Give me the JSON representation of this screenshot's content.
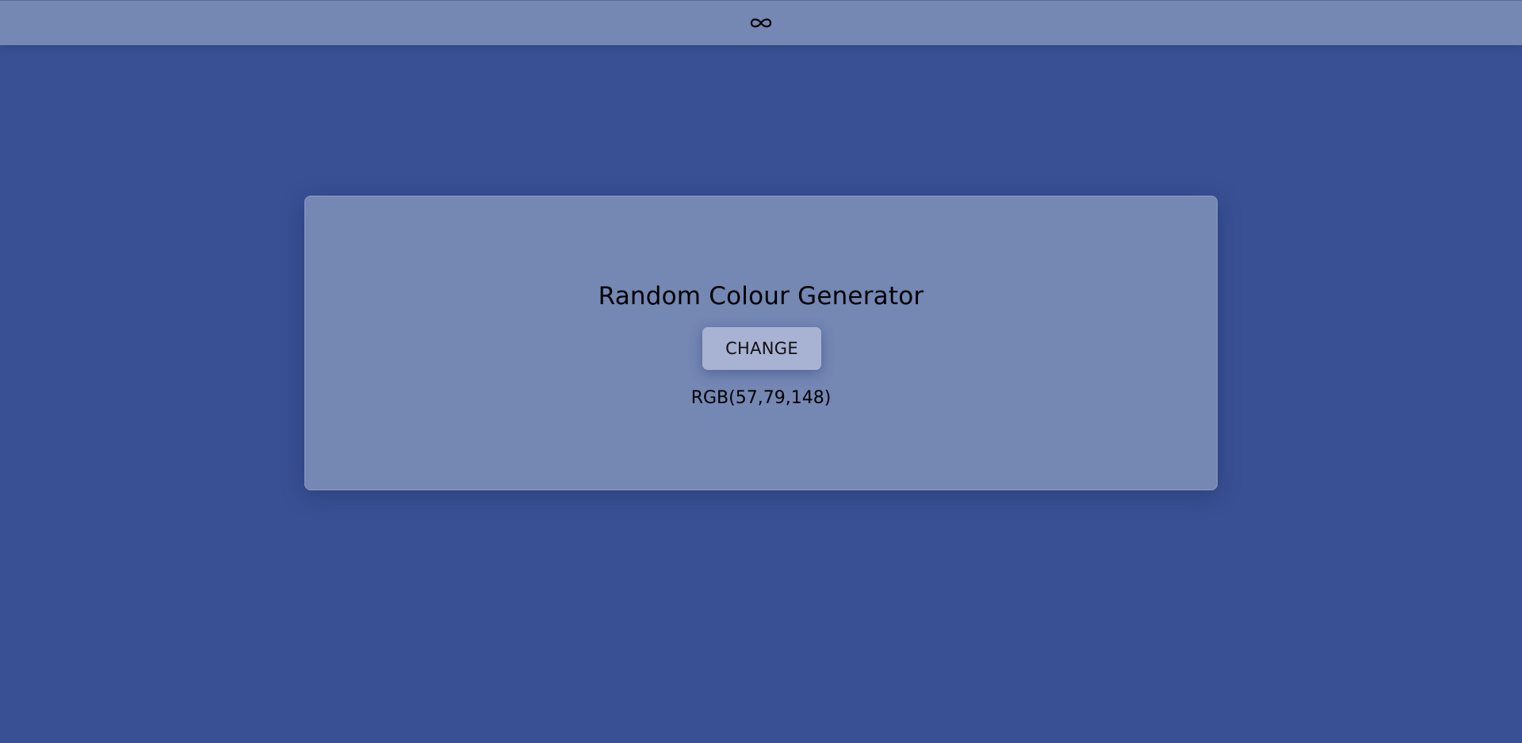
{
  "header": {
    "logo_icon": "infinity-icon"
  },
  "card": {
    "title": "Random Colour Generator",
    "button_label": "CHANGE",
    "rgb_value": "RGB(57,79,148)"
  },
  "colors": {
    "background": "#395194",
    "panel": "#7587b3",
    "button": "#a8b2d2"
  }
}
